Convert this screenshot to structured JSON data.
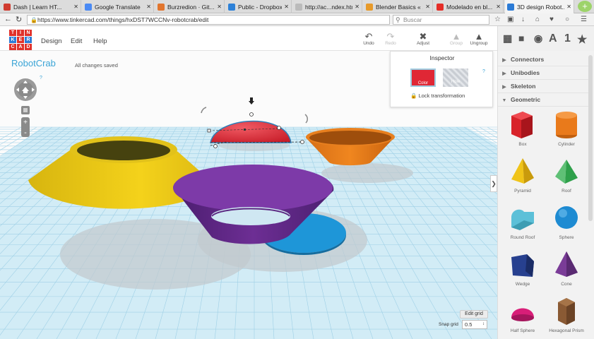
{
  "browser": {
    "tabs": [
      {
        "title": "Dash | Learn HT...",
        "color": "#d03b2f"
      },
      {
        "title": "Google Translate",
        "color": "#4a8af4"
      },
      {
        "title": "Burzredion · Git...",
        "color": "#e2762f"
      },
      {
        "title": "Public - Dropbox",
        "color": "#2d81d8"
      },
      {
        "title": "http://ac...ndex.html",
        "color": "#bbbbbb"
      },
      {
        "title": "Blender Basics « ...",
        "color": "#e79a2a"
      },
      {
        "title": "Modelado en bl...",
        "color": "#e52d27"
      },
      {
        "title": "3D design Robot...",
        "color": "#2c7bd6"
      }
    ],
    "url": "https://www.tinkercad.com/things/hxDST7WCCNv-robotcrab/edit",
    "search_placeholder": "Buscar"
  },
  "app": {
    "logo_letters": [
      "T",
      "I",
      "N",
      "K",
      "E",
      "R",
      "C",
      "A",
      "D"
    ],
    "menus": [
      "Design",
      "Edit",
      "Help"
    ],
    "tools": [
      {
        "label": "Undo",
        "icon": "undo-icon",
        "enabled": true
      },
      {
        "label": "Redo",
        "icon": "redo-icon",
        "enabled": false
      },
      {
        "label": "Adjust",
        "icon": "adjust-icon",
        "enabled": true
      },
      {
        "label": "Group",
        "icon": "group-icon",
        "enabled": false
      },
      {
        "label": "Ungroup",
        "icon": "ungroup-icon",
        "enabled": true
      }
    ],
    "right_toolbar": [
      "grid-view-icon",
      "box-view-icon",
      "shapes-view-icon",
      "A",
      "1",
      "star-icon"
    ],
    "project_name": "RobotCrab",
    "save_status": "All changes saved",
    "help": "?"
  },
  "inspector": {
    "title": "Inspector",
    "color_label": "Color",
    "hole_label": "Hole",
    "help": "?",
    "lock_label": "Lock transformation"
  },
  "sidebar": {
    "categories": [
      {
        "label": "Connectors",
        "expanded": false
      },
      {
        "label": "Unibodies",
        "expanded": false
      },
      {
        "label": "Skeleton",
        "expanded": false
      },
      {
        "label": "Geometric",
        "expanded": true
      }
    ],
    "shapes": [
      {
        "label": "Box",
        "icon": "box-icon",
        "color": "#d8232a"
      },
      {
        "label": "Cylinder",
        "icon": "cylinder-icon",
        "color": "#e97a1b"
      },
      {
        "label": "Pyramid",
        "icon": "pyramid-icon",
        "color": "#f0c419"
      },
      {
        "label": "Roof",
        "icon": "roof-icon",
        "color": "#2ea04a"
      },
      {
        "label": "Round Roof",
        "icon": "round-roof-icon",
        "color": "#5cc0d8"
      },
      {
        "label": "Sphere",
        "icon": "sphere-icon",
        "color": "#1e8bd2"
      },
      {
        "label": "Wedge",
        "icon": "wedge-icon",
        "color": "#27408f"
      },
      {
        "label": "Cone",
        "icon": "cone-icon",
        "color": "#7a3c97"
      },
      {
        "label": "Half Sphere",
        "icon": "half-sphere-icon",
        "color": "#d81e78"
      },
      {
        "label": "Hexagonal Prism",
        "icon": "hexagonal-prism-icon",
        "color": "#8a5a34"
      }
    ]
  },
  "workplane": {
    "edit_grid_label": "Edit grid",
    "snap_grid_label": "Snap grid",
    "snap_grid_value": "0.5",
    "objects": [
      {
        "name": "yellow-cone-frustum",
        "color": "#f2cf1a"
      },
      {
        "name": "purple-bowl",
        "color": "#6e2f97"
      },
      {
        "name": "blue-disc",
        "color": "#1e96d8"
      },
      {
        "name": "orange-bowl",
        "color": "#e37a1e"
      },
      {
        "name": "red-half-sphere",
        "color": "#dc2b35"
      }
    ]
  }
}
